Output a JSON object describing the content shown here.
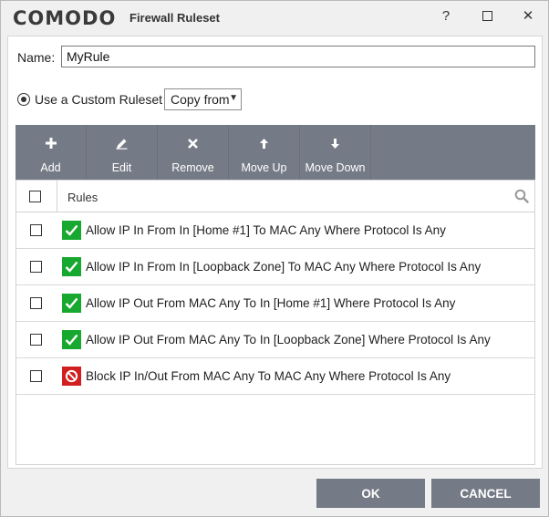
{
  "window": {
    "logo": "COMODO",
    "title": "Firewall Ruleset",
    "help_label": "?",
    "close_label": "✕"
  },
  "form": {
    "name_label": "Name:",
    "name_value": "MyRule",
    "radio_label": "Use a Custom Ruleset",
    "copy_from_label": "Copy from"
  },
  "toolbar": {
    "items": [
      {
        "label": "Add",
        "icon": "plus-icon"
      },
      {
        "label": "Edit",
        "icon": "pencil-icon"
      },
      {
        "label": "Remove",
        "icon": "x-icon"
      },
      {
        "label": "Move Up",
        "icon": "arrow-up-icon"
      },
      {
        "label": "Move Down",
        "icon": "arrow-down-icon"
      }
    ]
  },
  "table": {
    "header_label": "Rules",
    "rows": [
      {
        "type": "allow",
        "text": "Allow IP In From In [Home #1] To MAC Any Where Protocol Is Any"
      },
      {
        "type": "allow",
        "text": "Allow IP In From In [Loopback Zone] To MAC Any Where Protocol Is Any"
      },
      {
        "type": "allow",
        "text": "Allow IP Out From MAC Any To In [Home #1] Where Protocol Is Any"
      },
      {
        "type": "allow",
        "text": "Allow IP Out From MAC Any To In [Loopback Zone] Where Protocol Is Any"
      },
      {
        "type": "block",
        "text": "Block IP In/Out From MAC Any To MAC Any Where Protocol Is Any"
      }
    ]
  },
  "buttons": {
    "ok_label": "OK",
    "cancel_label": "CANCEL"
  },
  "colors": {
    "toolbar_bg": "#757b86",
    "allow_green": "#17a82f",
    "block_red": "#d21f1f"
  }
}
